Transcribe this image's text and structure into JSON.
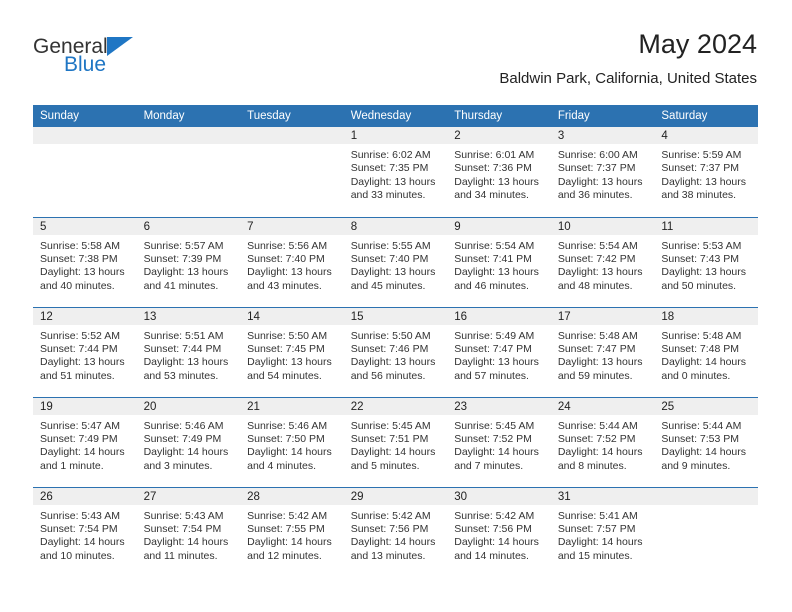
{
  "brand": {
    "name_top": "General",
    "name_bottom": "Blue",
    "accent_color": "#1f76c4"
  },
  "header": {
    "title": "May 2024",
    "location": "Baldwin Park, California, United States"
  },
  "theme": {
    "header_blue": "#2c72b1",
    "daynum_band": "#efefef",
    "text": "#222222"
  },
  "weekday_headers": [
    "Sunday",
    "Monday",
    "Tuesday",
    "Wednesday",
    "Thursday",
    "Friday",
    "Saturday"
  ],
  "weeks": [
    [
      {
        "day": "",
        "lines": []
      },
      {
        "day": "",
        "lines": []
      },
      {
        "day": "",
        "lines": []
      },
      {
        "day": "1",
        "lines": [
          "Sunrise: 6:02 AM",
          "Sunset: 7:35 PM",
          "Daylight: 13 hours",
          "and 33 minutes."
        ]
      },
      {
        "day": "2",
        "lines": [
          "Sunrise: 6:01 AM",
          "Sunset: 7:36 PM",
          "Daylight: 13 hours",
          "and 34 minutes."
        ]
      },
      {
        "day": "3",
        "lines": [
          "Sunrise: 6:00 AM",
          "Sunset: 7:37 PM",
          "Daylight: 13 hours",
          "and 36 minutes."
        ]
      },
      {
        "day": "4",
        "lines": [
          "Sunrise: 5:59 AM",
          "Sunset: 7:37 PM",
          "Daylight: 13 hours",
          "and 38 minutes."
        ]
      }
    ],
    [
      {
        "day": "5",
        "lines": [
          "Sunrise: 5:58 AM",
          "Sunset: 7:38 PM",
          "Daylight: 13 hours",
          "and 40 minutes."
        ]
      },
      {
        "day": "6",
        "lines": [
          "Sunrise: 5:57 AM",
          "Sunset: 7:39 PM",
          "Daylight: 13 hours",
          "and 41 minutes."
        ]
      },
      {
        "day": "7",
        "lines": [
          "Sunrise: 5:56 AM",
          "Sunset: 7:40 PM",
          "Daylight: 13 hours",
          "and 43 minutes."
        ]
      },
      {
        "day": "8",
        "lines": [
          "Sunrise: 5:55 AM",
          "Sunset: 7:40 PM",
          "Daylight: 13 hours",
          "and 45 minutes."
        ]
      },
      {
        "day": "9",
        "lines": [
          "Sunrise: 5:54 AM",
          "Sunset: 7:41 PM",
          "Daylight: 13 hours",
          "and 46 minutes."
        ]
      },
      {
        "day": "10",
        "lines": [
          "Sunrise: 5:54 AM",
          "Sunset: 7:42 PM",
          "Daylight: 13 hours",
          "and 48 minutes."
        ]
      },
      {
        "day": "11",
        "lines": [
          "Sunrise: 5:53 AM",
          "Sunset: 7:43 PM",
          "Daylight: 13 hours",
          "and 50 minutes."
        ]
      }
    ],
    [
      {
        "day": "12",
        "lines": [
          "Sunrise: 5:52 AM",
          "Sunset: 7:44 PM",
          "Daylight: 13 hours",
          "and 51 minutes."
        ]
      },
      {
        "day": "13",
        "lines": [
          "Sunrise: 5:51 AM",
          "Sunset: 7:44 PM",
          "Daylight: 13 hours",
          "and 53 minutes."
        ]
      },
      {
        "day": "14",
        "lines": [
          "Sunrise: 5:50 AM",
          "Sunset: 7:45 PM",
          "Daylight: 13 hours",
          "and 54 minutes."
        ]
      },
      {
        "day": "15",
        "lines": [
          "Sunrise: 5:50 AM",
          "Sunset: 7:46 PM",
          "Daylight: 13 hours",
          "and 56 minutes."
        ]
      },
      {
        "day": "16",
        "lines": [
          "Sunrise: 5:49 AM",
          "Sunset: 7:47 PM",
          "Daylight: 13 hours",
          "and 57 minutes."
        ]
      },
      {
        "day": "17",
        "lines": [
          "Sunrise: 5:48 AM",
          "Sunset: 7:47 PM",
          "Daylight: 13 hours",
          "and 59 minutes."
        ]
      },
      {
        "day": "18",
        "lines": [
          "Sunrise: 5:48 AM",
          "Sunset: 7:48 PM",
          "Daylight: 14 hours",
          "and 0 minutes."
        ]
      }
    ],
    [
      {
        "day": "19",
        "lines": [
          "Sunrise: 5:47 AM",
          "Sunset: 7:49 PM",
          "Daylight: 14 hours",
          "and 1 minute."
        ]
      },
      {
        "day": "20",
        "lines": [
          "Sunrise: 5:46 AM",
          "Sunset: 7:49 PM",
          "Daylight: 14 hours",
          "and 3 minutes."
        ]
      },
      {
        "day": "21",
        "lines": [
          "Sunrise: 5:46 AM",
          "Sunset: 7:50 PM",
          "Daylight: 14 hours",
          "and 4 minutes."
        ]
      },
      {
        "day": "22",
        "lines": [
          "Sunrise: 5:45 AM",
          "Sunset: 7:51 PM",
          "Daylight: 14 hours",
          "and 5 minutes."
        ]
      },
      {
        "day": "23",
        "lines": [
          "Sunrise: 5:45 AM",
          "Sunset: 7:52 PM",
          "Daylight: 14 hours",
          "and 7 minutes."
        ]
      },
      {
        "day": "24",
        "lines": [
          "Sunrise: 5:44 AM",
          "Sunset: 7:52 PM",
          "Daylight: 14 hours",
          "and 8 minutes."
        ]
      },
      {
        "day": "25",
        "lines": [
          "Sunrise: 5:44 AM",
          "Sunset: 7:53 PM",
          "Daylight: 14 hours",
          "and 9 minutes."
        ]
      }
    ],
    [
      {
        "day": "26",
        "lines": [
          "Sunrise: 5:43 AM",
          "Sunset: 7:54 PM",
          "Daylight: 14 hours",
          "and 10 minutes."
        ]
      },
      {
        "day": "27",
        "lines": [
          "Sunrise: 5:43 AM",
          "Sunset: 7:54 PM",
          "Daylight: 14 hours",
          "and 11 minutes."
        ]
      },
      {
        "day": "28",
        "lines": [
          "Sunrise: 5:42 AM",
          "Sunset: 7:55 PM",
          "Daylight: 14 hours",
          "and 12 minutes."
        ]
      },
      {
        "day": "29",
        "lines": [
          "Sunrise: 5:42 AM",
          "Sunset: 7:56 PM",
          "Daylight: 14 hours",
          "and 13 minutes."
        ]
      },
      {
        "day": "30",
        "lines": [
          "Sunrise: 5:42 AM",
          "Sunset: 7:56 PM",
          "Daylight: 14 hours",
          "and 14 minutes."
        ]
      },
      {
        "day": "31",
        "lines": [
          "Sunrise: 5:41 AM",
          "Sunset: 7:57 PM",
          "Daylight: 14 hours",
          "and 15 minutes."
        ]
      },
      {
        "day": "",
        "lines": []
      }
    ]
  ]
}
